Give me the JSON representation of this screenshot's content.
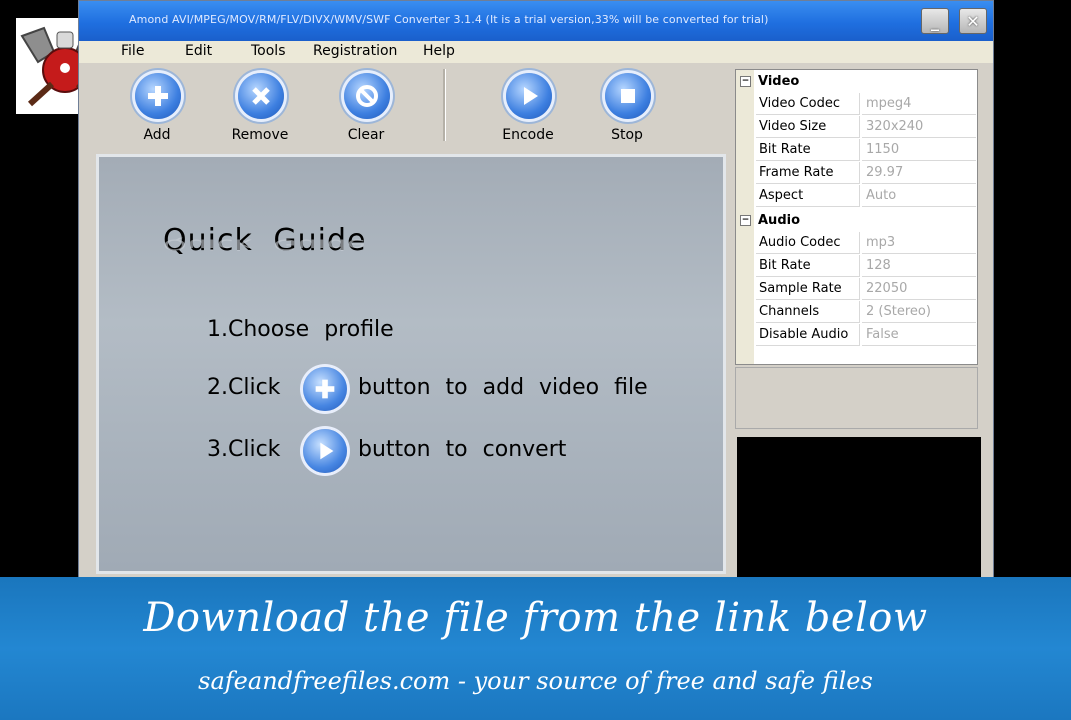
{
  "window": {
    "title": "Amond AVI/MPEG/MOV/RM/FLV/DIVX/WMV/SWF Converter 3.1.4 (It is a trial version,33% will be converted for trial)",
    "minimize_glyph": "_",
    "close_glyph": "✕"
  },
  "menu": [
    "File",
    "Edit",
    "Tools",
    "Registration",
    "Help"
  ],
  "toolbar": {
    "add": "Add",
    "remove": "Remove",
    "clear": "Clear",
    "encode": "Encode",
    "stop": "Stop"
  },
  "guide": {
    "title": "Quick Guide",
    "step1": "1.Choose profile",
    "step2_prefix": "2.Click",
    "step2_suffix": "button to add video file",
    "step3_prefix": "3.Click",
    "step3_suffix": "button to convert"
  },
  "properties": {
    "video": {
      "label": "Video",
      "toggle": "−",
      "rows": [
        {
          "name": "Video Codec",
          "value": "mpeg4"
        },
        {
          "name": "Video Size",
          "value": "320x240"
        },
        {
          "name": "Bit Rate",
          "value": "1150"
        },
        {
          "name": "Frame Rate",
          "value": "29.97"
        },
        {
          "name": "Aspect",
          "value": "Auto"
        }
      ]
    },
    "audio": {
      "label": "Audio",
      "toggle": "−",
      "rows": [
        {
          "name": "Audio Codec",
          "value": "mp3"
        },
        {
          "name": "Bit Rate",
          "value": "128"
        },
        {
          "name": "Sample Rate",
          "value": "22050"
        },
        {
          "name": "Channels",
          "value": "2 (Stereo)"
        },
        {
          "name": "Disable Audio",
          "value": "False"
        }
      ]
    }
  },
  "banner": {
    "line1": "Download the file from the link below",
    "line2": "safeandfreefiles.com - your source of free and safe files"
  },
  "colors": {
    "titlebar": "#1f6fe0",
    "banner": "#2387d2",
    "icon_blue": "#3d7fe0"
  }
}
